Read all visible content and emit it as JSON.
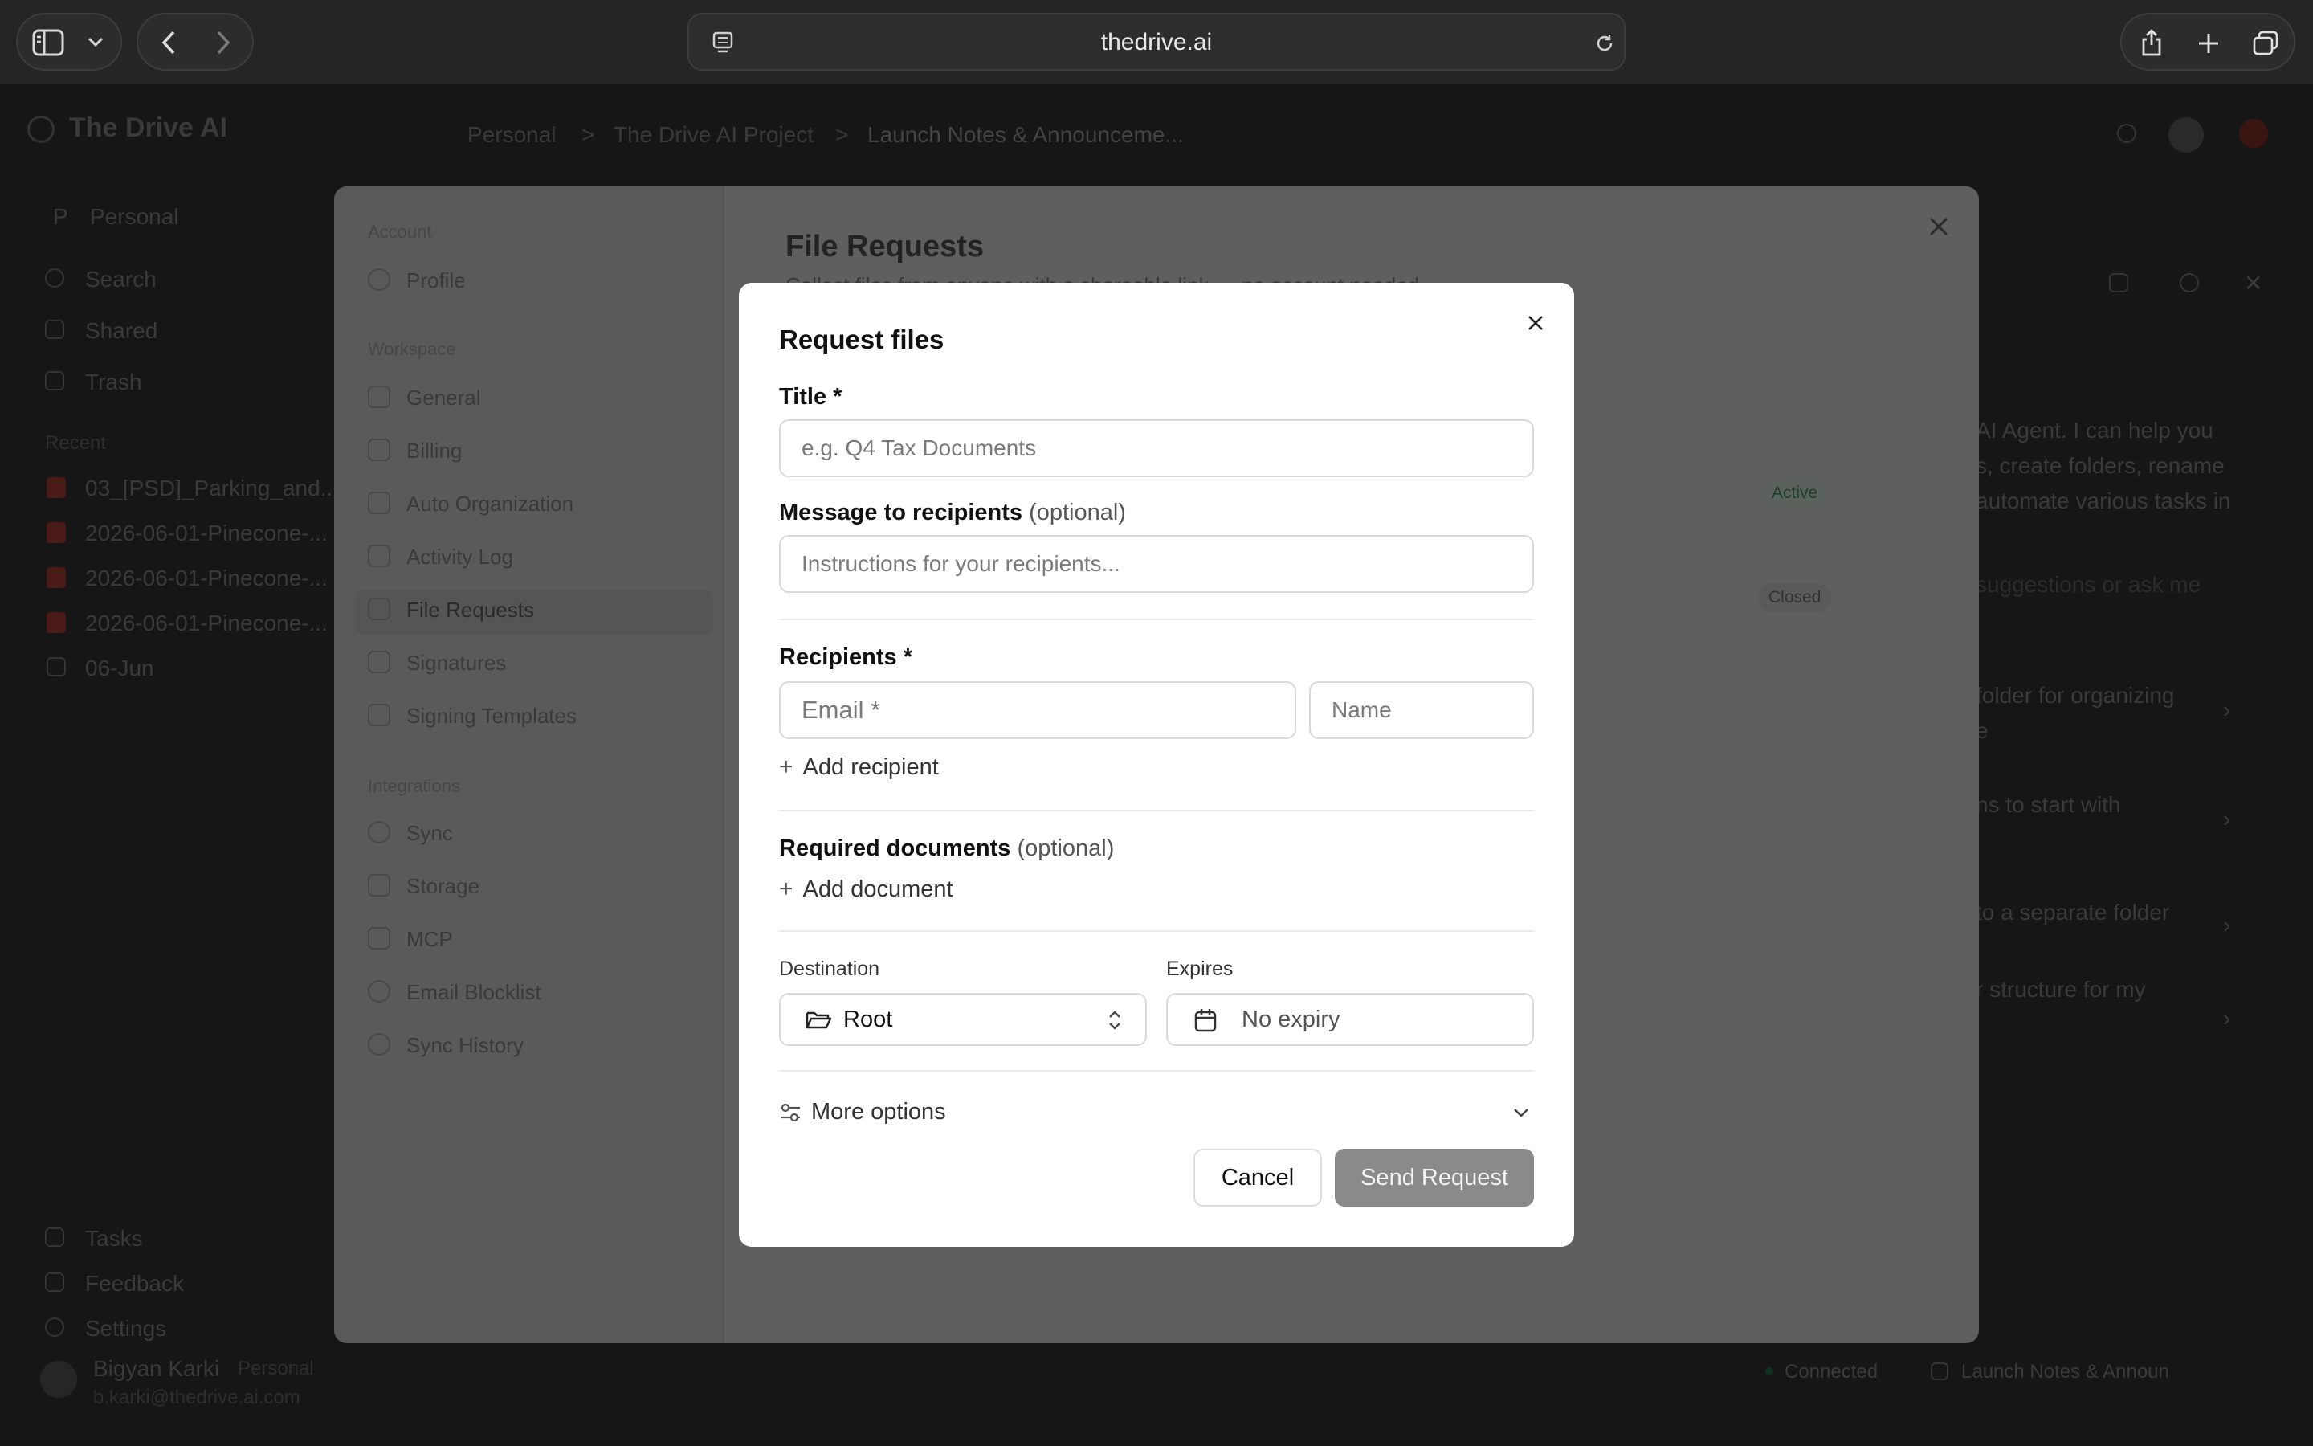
{
  "browser": {
    "url": "thedrive.ai"
  },
  "app": {
    "logo_text": "The Drive AI",
    "workspace_initial": "P",
    "workspace_name": "Personal",
    "breadcrumb": [
      "Personal",
      "The Drive AI Project",
      "Launch Notes & Announceme..."
    ],
    "nav": [
      {
        "label": "Search",
        "icon": "search-icon"
      },
      {
        "label": "Shared",
        "icon": "share-icon"
      },
      {
        "label": "Trash",
        "icon": "trash-icon"
      }
    ],
    "recent_label": "Recent",
    "recent_files": [
      "03_[PSD]_Parking_and...",
      "2026-06-01-Pinecone-...",
      "2026-06-01-Pinecone-...",
      "2026-06-01-Pinecone-...",
      "06-Jun"
    ],
    "bottom_nav": [
      "Tasks",
      "Feedback",
      "Settings"
    ],
    "user": {
      "name": "Bigyan Karki",
      "plan": "Personal",
      "email": "b.karki@thedrive.ai.com"
    },
    "chat_snippets": [
      "AI Agent. I can help you",
      "s, create folders, rename",
      "automate various tasks in",
      "suggestions or ask me",
      "folder for organizing",
      "e",
      "ns to start with",
      "to a separate folder",
      "r structure for my"
    ],
    "status": {
      "connected": "Connected",
      "file": "Launch Notes & Announ"
    }
  },
  "settings": {
    "sections": [
      {
        "title": "Account",
        "items": [
          "Profile"
        ]
      },
      {
        "title": "Workspace",
        "items": [
          "General",
          "Billing",
          "Auto Organization",
          "Activity Log",
          "File Requests",
          "Signatures",
          "Signing Templates"
        ]
      },
      {
        "title": "Integrations",
        "items": [
          "Sync",
          "Storage",
          "MCP",
          "Email Blocklist",
          "Sync History"
        ]
      }
    ],
    "active_item": "File Requests",
    "page_title": "File Requests",
    "page_subtitle": "Collect files from anyone with a shareable link — no account needed.",
    "badges": [
      "Active",
      "Closed"
    ]
  },
  "modal": {
    "title": "Request files",
    "title_label": "Title *",
    "title_placeholder": "e.g. Q4 Tax Documents",
    "message_label": "Message to recipients",
    "message_optional": "(optional)",
    "message_placeholder": "Instructions for your recipients...",
    "recipients_label": "Recipients *",
    "email_placeholder": "Email *",
    "name_placeholder": "Name",
    "add_recipient": "Add recipient",
    "required_docs_label": "Required documents",
    "required_docs_optional": "(optional)",
    "add_document": "Add document",
    "destination_label": "Destination",
    "destination_value": "Root",
    "expires_label": "Expires",
    "expires_value": "No expiry",
    "more_options": "More options",
    "cancel": "Cancel",
    "send": "Send Request"
  },
  "colors": {
    "send_button_disabled": "#8a8a8a",
    "active_badge": "#1f6f3a"
  }
}
